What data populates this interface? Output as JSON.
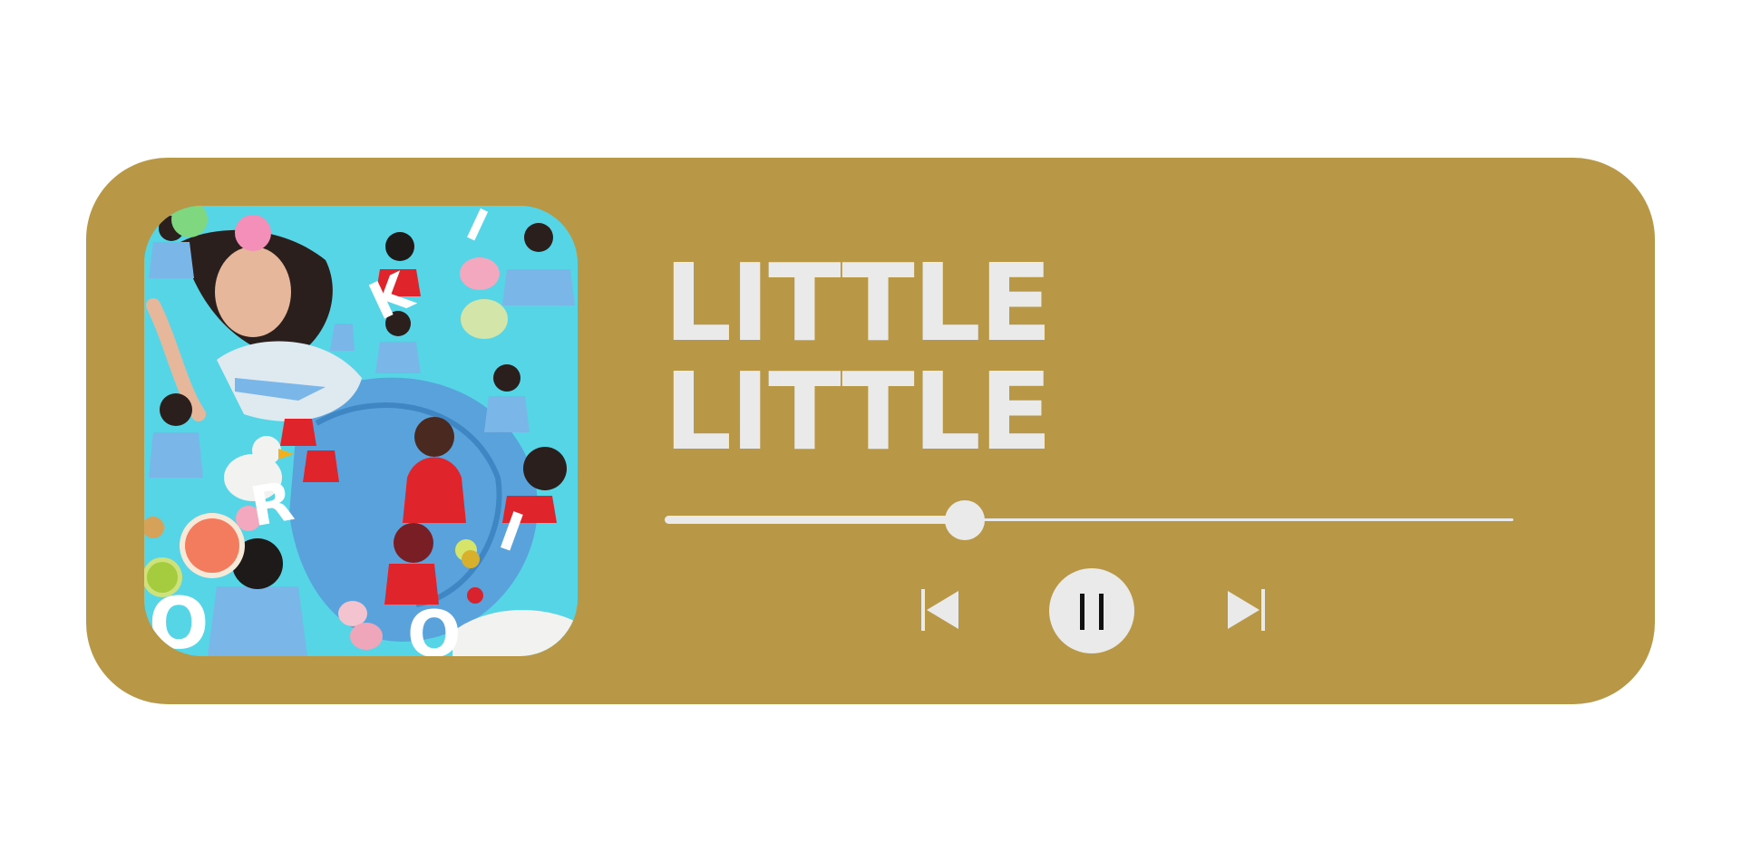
{
  "track": {
    "title_line1": "LITTLE",
    "title_line2": "LITTLE",
    "progress": 0.354
  },
  "cover_art": {
    "letters": [
      "O",
      "R",
      "I",
      "K",
      "I",
      "O"
    ]
  },
  "colors": {
    "card_background": "#b89846",
    "foreground": "#eaeaea",
    "cover_background": "#56d5e6",
    "page_background": "#ffffff"
  },
  "icons": {
    "previous": "skip-previous-icon",
    "play_pause": "pause-icon",
    "next": "skip-next-icon"
  }
}
